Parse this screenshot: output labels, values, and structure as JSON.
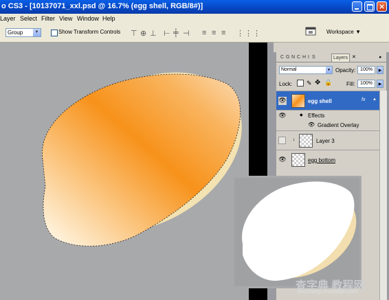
{
  "window": {
    "title": "o CS3 - [10137071_xxl.psd @ 16.7% (egg shell, RGB/8#)]"
  },
  "menu": {
    "items": [
      "Layer",
      "Select",
      "Filter",
      "View",
      "Window",
      "Help"
    ]
  },
  "options": {
    "auto_select_value": "Group",
    "show_transform_label": "Show Transform Controls",
    "workspace_label": "Workspace ▼"
  },
  "layers_panel": {
    "tabs": [
      "C",
      "G",
      "N",
      "C",
      "H",
      "I",
      "S",
      "Layers"
    ],
    "active_tab": "Layers",
    "blend_mode": "Normal",
    "opacity_label": "Opacity:",
    "opacity_value": "100%",
    "lock_label": "Lock:",
    "fill_label": "Fill:",
    "fill_value": "100%",
    "layers": [
      {
        "name": "egg shell",
        "selected": true,
        "fx": "fx"
      },
      {
        "name": "Effects",
        "sub": true
      },
      {
        "name": "Gradient Overlay",
        "sub": true
      },
      {
        "name": "Layer 3",
        "selected": false
      },
      {
        "name": "egg bottom",
        "selected": false
      }
    ]
  },
  "watermark": {
    "text": "查字典 教程网",
    "subtext": "jiaocheng.chazidian.com"
  },
  "colors": {
    "titlebar": "#0a5fe6",
    "egg_orange": "#f7941d",
    "egg_cream": "#f4e4b6",
    "selected_layer": "#316ac5"
  }
}
